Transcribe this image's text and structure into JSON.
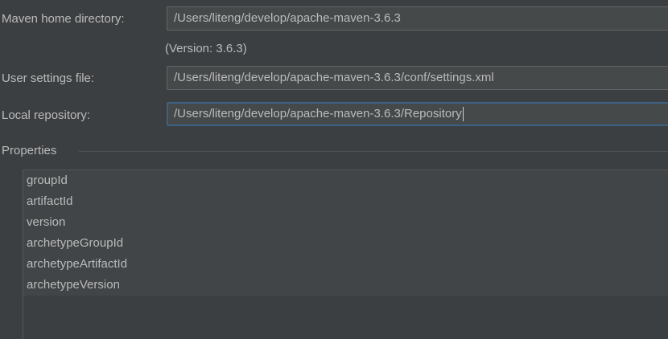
{
  "form": {
    "maven_home": {
      "label": "Maven home directory:",
      "value": "/Users/liteng/develop/apache-maven-3.6.3",
      "version_note": "(Version: 3.6.3)"
    },
    "user_settings": {
      "label": "User settings file:",
      "value": "/Users/liteng/develop/apache-maven-3.6.3/conf/settings.xml"
    },
    "local_repository": {
      "label": "Local repository:",
      "value": "/Users/liteng/develop/apache-maven-3.6.3/Repository"
    }
  },
  "properties": {
    "title": "Properties",
    "items": [
      "groupId",
      "artifactId",
      "version",
      "archetypeGroupId",
      "archetypeArtifactId",
      "archetypeVersion"
    ]
  }
}
